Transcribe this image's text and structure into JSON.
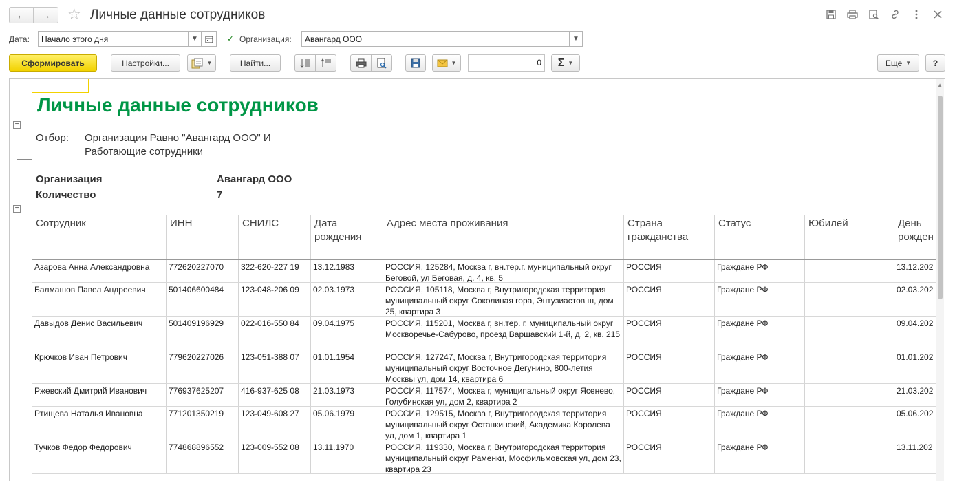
{
  "window": {
    "title": "Личные данные сотрудников",
    "back_icon": "←",
    "forward_icon": "→",
    "star_icon": "☆",
    "icons": [
      {
        "name": "save-icon",
        "glyph": "💾"
      },
      {
        "name": "print-icon",
        "glyph": "⎙"
      },
      {
        "name": "preview-icon",
        "glyph": "🗋"
      },
      {
        "name": "link-icon",
        "glyph": "🔗"
      },
      {
        "name": "more-icon",
        "glyph": "⋮"
      },
      {
        "name": "close-icon",
        "glyph": "✕"
      }
    ]
  },
  "filters": {
    "date_label": "Дата:",
    "date_value": "Начало этого дня",
    "org_checkbox": "✓",
    "org_label": "Организация:",
    "org_value": "Авангард ООО"
  },
  "toolbar": {
    "generate": "Сформировать",
    "settings": "Настройки...",
    "find": "Найти...",
    "number_value": "0",
    "sum_icon": "Σ",
    "more": "Еще",
    "help": "?"
  },
  "report": {
    "title": "Личные данные сотрудников",
    "filter_label": "Отбор:",
    "filter_line1": "Организация Равно \"Авангард ООО\" И",
    "filter_line2": "Работающие сотрудники",
    "org_label": "Организация",
    "org_value": "Авангард ООО",
    "count_label": "Количество",
    "count_value": "7",
    "columns": [
      "Сотрудник",
      "ИНН",
      "СНИЛС",
      "Дата\nрождения",
      "Адрес места проживания",
      "Страна\nгражданства",
      "Статус",
      "Юбилей",
      "День\nрожден"
    ],
    "rows": [
      {
        "name": "Азарова Анна Александровна",
        "inn": "772620227070",
        "snils": "322-620-227 19",
        "birth": "13.12.1983",
        "address": "РОССИЯ, 125284, Москва г, вн.тер.г. муниципальный округ Беговой, ул Беговая, д. 4, кв. 5",
        "country": "РОССИЯ",
        "status": "Граждане РФ",
        "jubilee": "",
        "bday": "13.12.202"
      },
      {
        "name": "Балмашов Павел Андреевич",
        "inn": "501406600484",
        "snils": "123-048-206 09",
        "birth": "02.03.1973",
        "address": "РОССИЯ, 105118, Москва г, Внутригородская территория муниципальный округ Соколиная гора, Энтузиастов ш, дом 25, квартира 3",
        "country": "РОССИЯ",
        "status": "Граждане РФ",
        "jubilee": "",
        "bday": "02.03.202"
      },
      {
        "name": "Давыдов Денис Васильевич",
        "inn": "501409196929",
        "snils": "022-016-550 84",
        "birth": "09.04.1975",
        "address": "РОССИЯ, 115201, Москва г, вн.тер. г. муниципальный округ Москворечье-Сабурово, проезд Варшавский 1-й, д. 2, кв. 215",
        "country": "РОССИЯ",
        "status": "Граждане РФ",
        "jubilee": "",
        "bday": "09.04.202"
      },
      {
        "name": "Крючков Иван Петрович",
        "inn": "779620227026",
        "snils": "123-051-388 07",
        "birth": "01.01.1954",
        "address": "РОССИЯ, 127247, Москва г, Внутригородская территория муниципальный округ Восточное Дегунино, 800-летия Москвы ул, дом 14, квартира 6",
        "country": "РОССИЯ",
        "status": "Граждане РФ",
        "jubilee": "",
        "bday": "01.01.202"
      },
      {
        "name": "Ржевский Дмитрий Иванович",
        "inn": "776937625207",
        "snils": "416-937-625 08",
        "birth": "21.03.1973",
        "address": "РОССИЯ, 117574, Москва г, муниципальный округ Ясенево, Голубинская ул, дом 2, квартира 2",
        "country": "РОССИЯ",
        "status": "Граждане РФ",
        "jubilee": "",
        "bday": "21.03.202"
      },
      {
        "name": "Ртищева Наталья Ивановна",
        "inn": "771201350219",
        "snils": "123-049-608 27",
        "birth": "05.06.1979",
        "address": "РОССИЯ, 129515, Москва г, Внутригородская территория муниципальный округ Останкинский, Академика Королева ул, дом 1, квартира 1",
        "country": "РОССИЯ",
        "status": "Граждане РФ",
        "jubilee": "",
        "bday": "05.06.202"
      },
      {
        "name": "Тучков Федор Федорович",
        "inn": "774868896552",
        "snils": "123-009-552 08",
        "birth": "13.11.1970",
        "address": "РОССИЯ, 119330, Москва г, Внутригородская территория муниципальный округ Раменки, Мосфильмовская ул, дом 23, квартира 23",
        "country": "РОССИЯ",
        "status": "Граждане РФ",
        "jubilee": "",
        "bday": "13.11.202"
      }
    ]
  },
  "colors": {
    "title_green": "#009646",
    "primary_button": "#f2d200"
  }
}
